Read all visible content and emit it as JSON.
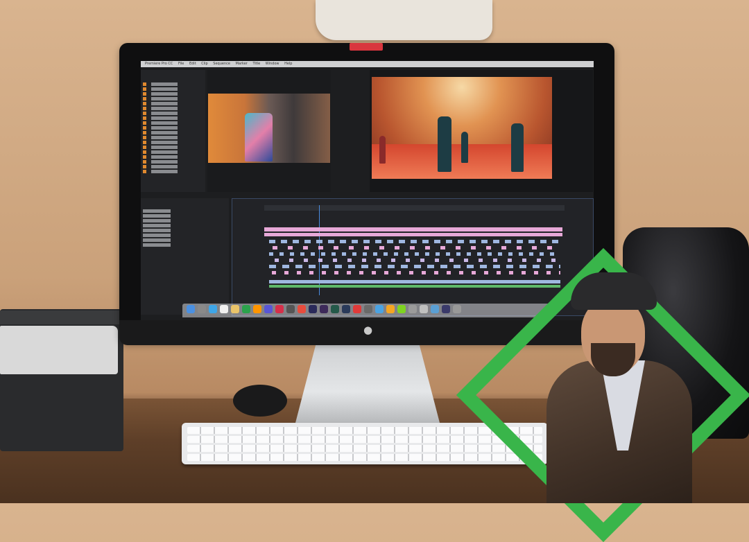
{
  "scene": {
    "description_tags": [
      "monitor-icon",
      "keyboard-icon",
      "person-icon"
    ]
  },
  "menubar": {
    "items": [
      "Premiere Pro CC",
      "File",
      "Edit",
      "Clip",
      "Sequence",
      "Marker",
      "Title",
      "Window",
      "Help"
    ]
  },
  "colors": {
    "accent": "#39b54a",
    "tape": "#d9363e",
    "wall": "#d9b48f"
  }
}
